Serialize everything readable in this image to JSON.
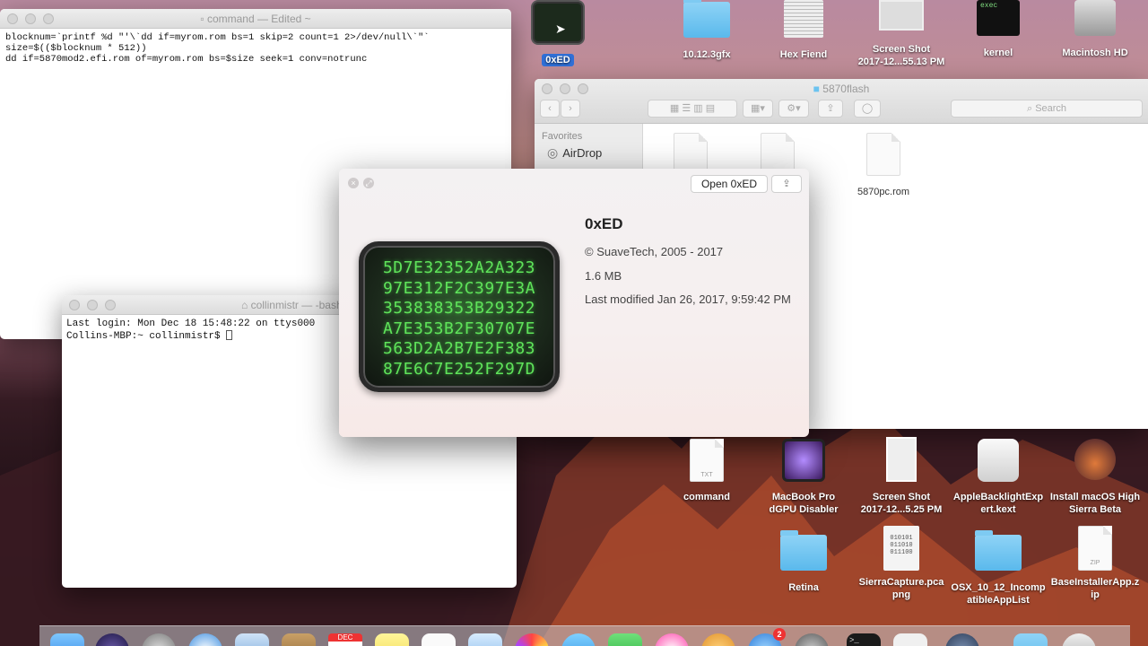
{
  "textedit": {
    "title": "command",
    "edited": "— Edited ~",
    "lines": [
      "blocknum=`printf %d \"'\\`dd if=myrom.rom bs=1 skip=2 count=1 2>/dev/null\\`\"`",
      "size=$(($blocknum * 512))",
      "dd if=5870mod2.efi.rom of=myrom.rom bs=$size seek=1 conv=notrunc"
    ]
  },
  "terminal": {
    "title": "collinmistr — -bash — 8",
    "lines": [
      "Last login: Mon Dec 18 15:48:22 on ttys000",
      "Collins-MBP:~ collinmistr$ "
    ]
  },
  "finder": {
    "title": "5870flash",
    "search_placeholder": "Search",
    "favorites_label": "Favorites",
    "sidebar_items": [
      {
        "label": "AirDrop",
        "icon": "airdrop-icon"
      }
    ],
    "file_label": "5870pc.rom"
  },
  "info": {
    "open_label": "Open 0xED",
    "app_name": "0xED",
    "copyright": "© SuaveTech, 2005 - 2017",
    "size": "1.6 MB",
    "modified": "Last modified Jan 26, 2017, 9:59:42 PM",
    "hex_lines": [
      "5D7E32352A2A323",
      "97E312F2C397E3A",
      "353838353B29322",
      "A7E353B2F30707E",
      "563D2A2B7E2F383",
      "87E6C7E252F297D"
    ]
  },
  "desktop": {
    "top_icons": [
      {
        "label": "0xED",
        "selected": true
      },
      {
        "label": "10.12.3gfx"
      },
      {
        "label": "Hex Fiend"
      },
      {
        "label": "Screen Shot\n2017-12...55.13 PM"
      },
      {
        "label": "kernel"
      },
      {
        "label": "Macintosh HD"
      }
    ],
    "kernel_text": "exec",
    "bottom_icons": [
      {
        "label": "command"
      },
      {
        "label": "MacBook Pro\ndGPU Disabler"
      },
      {
        "label": "Screen Shot\n2017-12...5.25 PM"
      },
      {
        "label": "AppleBacklightExp\nert.kext"
      },
      {
        "label": "Install macOS High\nSierra Beta"
      },
      {
        "label": "Retina"
      },
      {
        "label": "SierraCapture.pca\npng"
      },
      {
        "label": "OSX_10_12_Incomp\natibleAppList"
      },
      {
        "label": "BaseInstallerApp.z\nip"
      }
    ],
    "txt_tag": "TXT",
    "zip_tag": "ZIP",
    "binary_text": "010101\n011010\n011100"
  },
  "dock": {
    "calendar_month": "DEC",
    "badge_count": "2"
  },
  "colors": {
    "selection": "#2f6fd6",
    "folder": "#6cc3f0",
    "hex_green": "#5fe35a"
  }
}
